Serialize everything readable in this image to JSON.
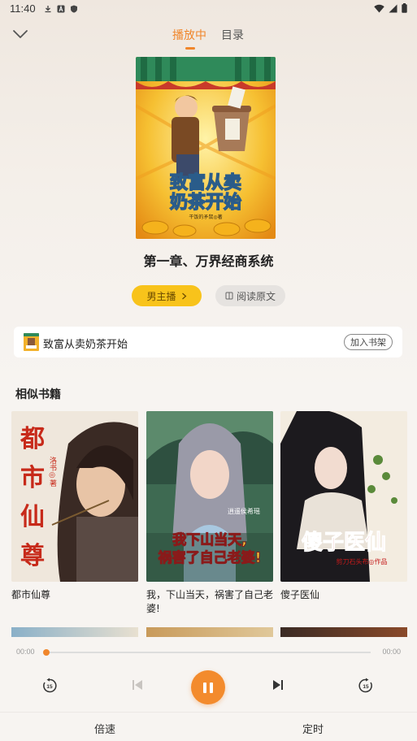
{
  "status": {
    "time": "11:40"
  },
  "tabs": [
    {
      "label": "播放中",
      "active": true
    },
    {
      "label": "目录",
      "active": false
    }
  ],
  "book": {
    "cover_title": "致富从卖奶茶开始",
    "cover_author": "干饭的矛鼠◎著",
    "chapter": "第一章、万界经商系统",
    "narrator_button": "男主播",
    "read_button": "阅读原文",
    "name": "致富从卖奶茶开始",
    "add_shelf": "加入书架"
  },
  "similar": {
    "title": "相似书籍",
    "items": [
      {
        "title": "都市仙尊",
        "cover_text": "都市仙尊",
        "author_text": "洛书◎著"
      },
      {
        "title": "我，下山当天，祸害了自己老婆!",
        "cover_text": "我下山当天，祸害了自己老婆!",
        "author_text": "逍遥侯希瑶"
      },
      {
        "title": "傻子医仙",
        "cover_text": "傻子医仙",
        "author_text": "剪刀石头布◎作品"
      }
    ]
  },
  "player": {
    "current_time": "00:00",
    "total_time": "00:00",
    "progress": 0,
    "speed_label": "倍速",
    "timer_label": "定时"
  },
  "colors": {
    "accent": "#f0862b",
    "narrator_bg": "#f8c31b"
  }
}
